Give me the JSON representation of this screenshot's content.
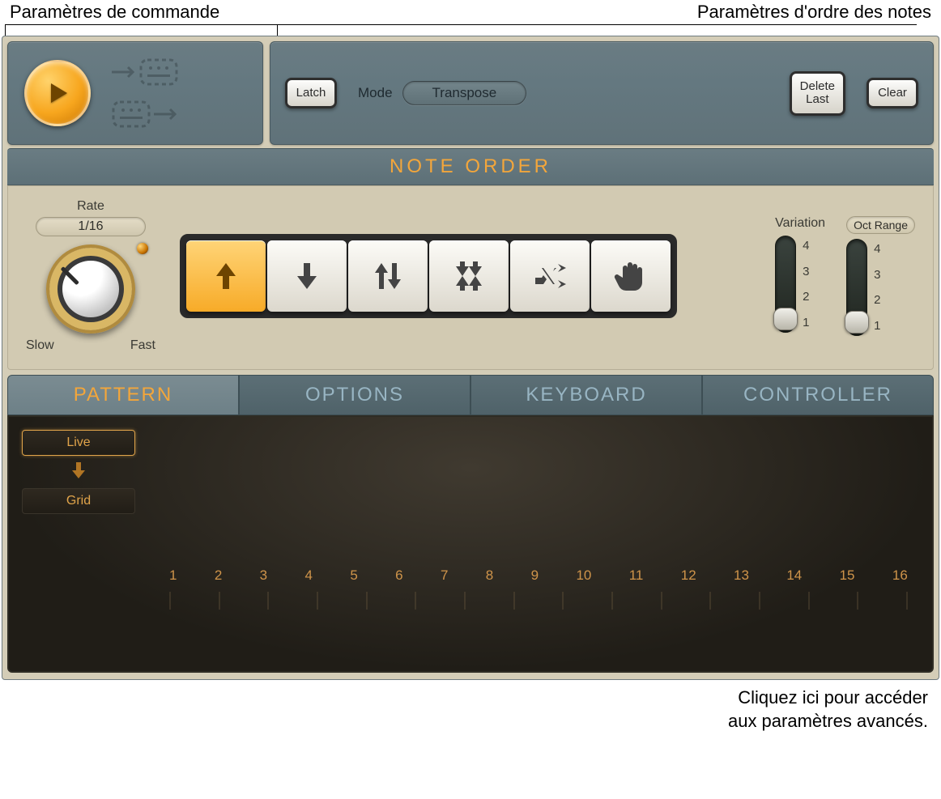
{
  "annotations": {
    "top_left": "Paramètres de commande",
    "top_right": "Paramètres d'ordre des notes",
    "bottom_1": "Cliquez ici pour accéder",
    "bottom_2": "aux paramètres avancés."
  },
  "control": {
    "latch": "Latch",
    "mode_label": "Mode",
    "mode_value": "Transpose",
    "delete_last": "Delete\nLast",
    "clear": "Clear"
  },
  "note_order": {
    "title": "NOTE ORDER",
    "rate_label": "Rate",
    "rate_value": "1/16",
    "slow": "Slow",
    "fast": "Fast",
    "directions": [
      "up",
      "down",
      "updown",
      "outside-in",
      "random",
      "manual"
    ],
    "active_direction": 0,
    "variation_label": "Variation",
    "oct_range_label": "Oct Range",
    "ticks": [
      "4",
      "3",
      "2",
      "1"
    ],
    "variation_value": 1,
    "oct_range_value": 1
  },
  "tabs": {
    "items": [
      "PATTERN",
      "OPTIONS",
      "KEYBOARD",
      "CONTROLLER"
    ],
    "active": 0
  },
  "pattern": {
    "live": "Live",
    "grid": "Grid",
    "steps": [
      "1",
      "2",
      "3",
      "4",
      "5",
      "6",
      "7",
      "8",
      "9",
      "10",
      "11",
      "12",
      "13",
      "14",
      "15",
      "16"
    ]
  }
}
